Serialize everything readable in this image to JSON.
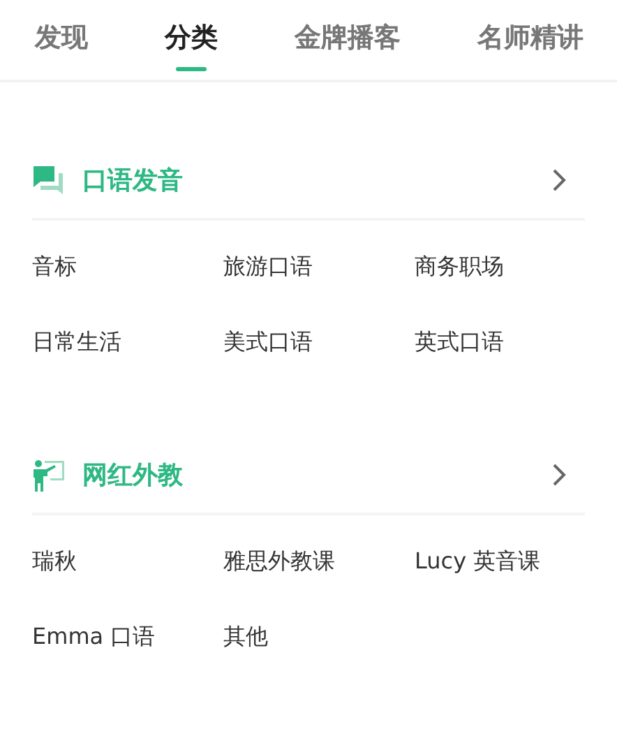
{
  "tabs": [
    {
      "label": "发现",
      "selected": false
    },
    {
      "label": "分类",
      "selected": true
    },
    {
      "label": "金牌播客",
      "selected": false
    },
    {
      "label": "名师精讲",
      "selected": false
    }
  ],
  "sections": [
    {
      "kind": "chat",
      "title": "口语发音",
      "items": [
        "音标",
        "旅游口语",
        "商务职场",
        "日常生活",
        "美式口语",
        "英式口语"
      ]
    },
    {
      "kind": "teacher",
      "title": "网红外教",
      "items": [
        "瑞秋",
        "雅思外教课",
        "Lucy 英音课",
        "Emma 口语",
        "其他"
      ]
    }
  ]
}
